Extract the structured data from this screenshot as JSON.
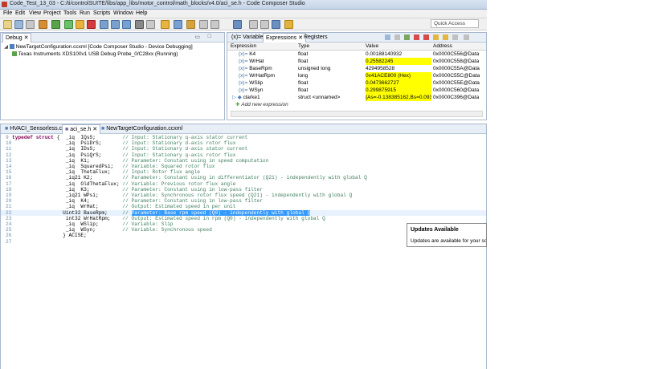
{
  "window": {
    "title": "Code_Test_13_03 - C:/ti/controlSUITE/libs/app_libs/motor_control/math_blocks/v4.0/aci_se.h - Code Composer Studio"
  },
  "menu": [
    "File",
    "Edit",
    "View",
    "Project",
    "Tools",
    "Run",
    "Scripts",
    "Window",
    "Help"
  ],
  "quick_access": {
    "label": "Quick Access"
  },
  "debug_panel": {
    "tab": "Debug",
    "items": [
      "NewTargetConfiguration.ccxml [Code Composer Studio - Device Debugging]",
      "Texas Instruments XDS100v1 USB Debug Probe_0/C28xx (Running)"
    ]
  },
  "expressions_panel": {
    "tabs": [
      "(x)= Variables",
      "Expressions",
      "Registers"
    ],
    "columns": [
      "Expression",
      "Type",
      "Value",
      "Address"
    ],
    "rows": [
      {
        "name": "K4",
        "type": "float",
        "value": "0.00188140932",
        "address": "0x0000C556@Data",
        "hl": false
      },
      {
        "name": "WrHat",
        "type": "float",
        "value": "0.25582245",
        "address": "0x0000C558@Data",
        "hl": true
      },
      {
        "name": "BaseRpm",
        "type": "unsigned long",
        "value": "4294958528",
        "address": "0x0000C55A@Data",
        "hl": false
      },
      {
        "name": "WrHatRpm",
        "type": "long",
        "value": "0x41ACE800 (Hex)",
        "address": "0x0000C55C@Data",
        "hl": true
      },
      {
        "name": "WSlip",
        "type": "float",
        "value": "0.0473662727",
        "address": "0x0000C55E@Data",
        "hl": true
      },
      {
        "name": "WSyn",
        "type": "float",
        "value": "0.299875915",
        "address": "0x0000C560@Data",
        "hl": true
      },
      {
        "name": "clarke1",
        "type": "struct <unnamed>",
        "value": "{As=-0.138385162,Bs=0.09300...",
        "address": "0x0000C396@Data",
        "hl": true
      }
    ],
    "add_new": "Add new expression"
  },
  "editor": {
    "tabs": [
      "HVACI_Sensorless.c",
      "aci_se.h",
      "NewTargetConfiguration.ccxml"
    ],
    "lines": [
      {
        "n": "9",
        "code": "typedef struct {  _iq  IQsS;         // Input: Stationary q-axis stator current"
      },
      {
        "n": "10",
        "code": "                  _iq  PsiDrS;       // Input: Stationary d-axis rotor flux"
      },
      {
        "n": "11",
        "code": "                  _iq  IDsS;         // Input: Stationary d-axis stator current"
      },
      {
        "n": "12",
        "code": "                  _iq  PsiQrS;       // Input: Stationary q-axis rotor flux"
      },
      {
        "n": "13",
        "code": "                  _iq  K1;           // Parameter: Constant using in speed computation"
      },
      {
        "n": "14",
        "code": "                  _iq  SquaredPsi;   // Variable: Squared rotor flux"
      },
      {
        "n": "15",
        "code": "                  _iq  ThetaFlux;    // Input: Rotor flux angle"
      },
      {
        "n": "16",
        "code": "                  _iq21 K2;          // Parameter: Constant using in differentiator (Q21) - independently with global Q"
      },
      {
        "n": "17",
        "code": "                  _iq  OldThetaFlux; // Variable: Previous rotor flux angle"
      },
      {
        "n": "18",
        "code": "                  _iq  K3;           // Parameter: Constant using in low-pass filter"
      },
      {
        "n": "19",
        "code": "                  _iq21 WPsi;        // Variable: Synchronous rotor flux speed (Q21) - independently with global Q"
      },
      {
        "n": "20",
        "code": "                  _iq  K4;           // Parameter: Constant using in low-pass filter"
      },
      {
        "n": "21",
        "code": "                  _iq  WrHat;        // Output: Estimated speed in per unit"
      },
      {
        "n": "22",
        "code": "                 Uint32 BaseRpm;     // Parameter: Base rpm speed (Q0) - independently with global Q"
      },
      {
        "n": "23",
        "code": "                  int32 WrHatRpm;    // Output: Estimated speed in rpm (Q0) - independently with global Q"
      },
      {
        "n": "24",
        "code": "                  _iq  WSlip;        // Variable: Slip"
      },
      {
        "n": "25",
        "code": "                  _iq  WSyn;         // Variable: Synchronous speed"
      },
      {
        "n": "26",
        "code": "                 } ACISE;"
      },
      {
        "n": "27",
        "code": ""
      }
    ],
    "highlight_line": "22",
    "highlight_text": "Parameter: Base rpm speed (Q0) - independently with global Q"
  },
  "popup": {
    "title": "Updates Available",
    "body": "Updates are available for your softw"
  },
  "colors": {
    "highlight": "#ffff00",
    "selection": "#3399ff",
    "comment": "#3f7f5f",
    "keyword": "#7f0055"
  }
}
